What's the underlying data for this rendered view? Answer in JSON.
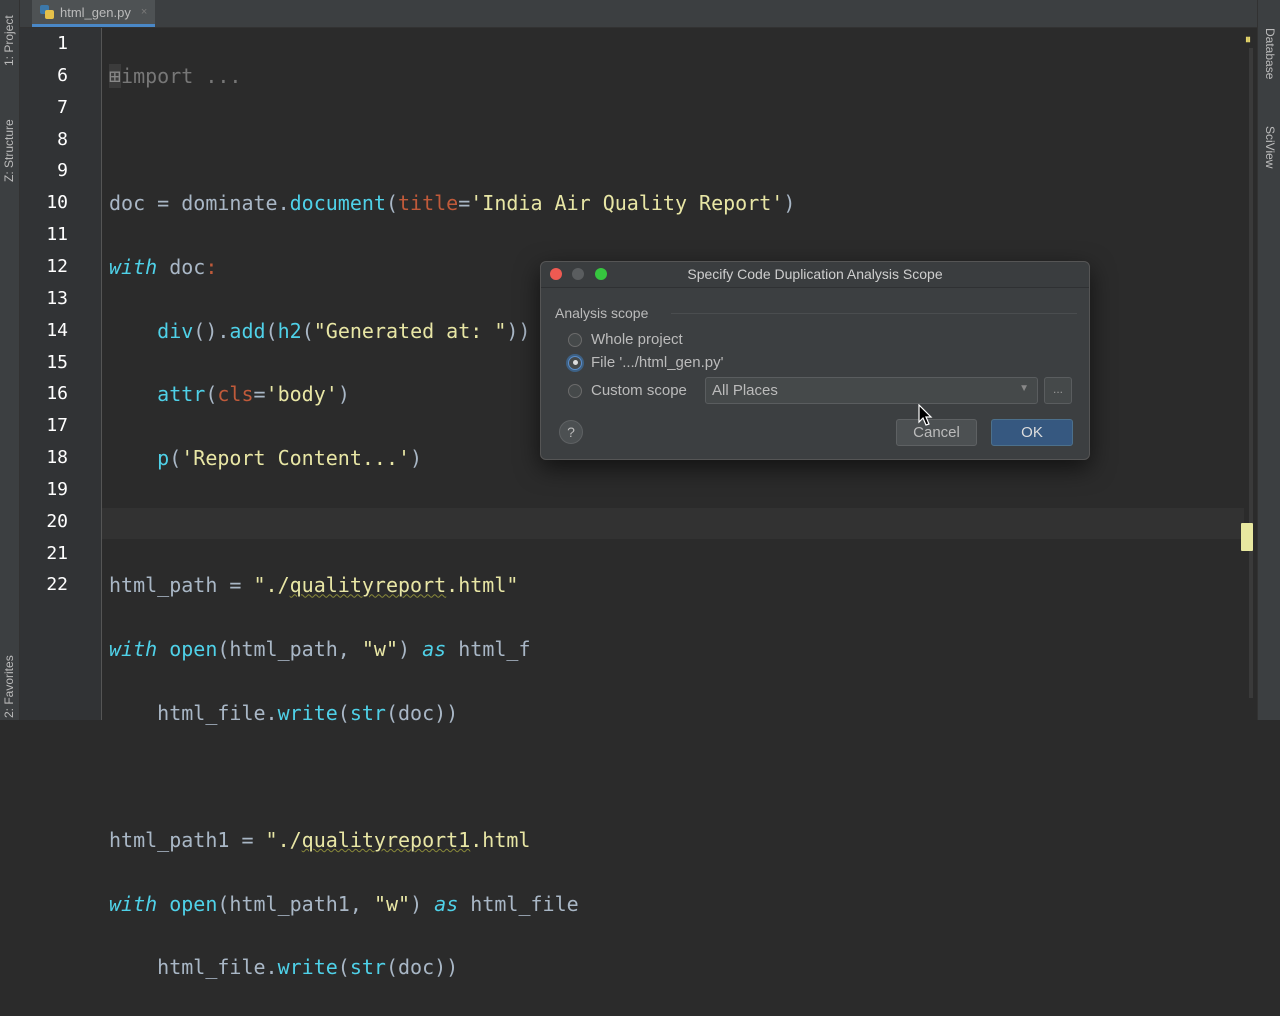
{
  "tab": {
    "filename": "html_gen.py",
    "close": "×"
  },
  "left_tools": {
    "project": "1: Project",
    "structure": "Z: Structure",
    "favorites": "2: Favorites"
  },
  "right_tools": {
    "database": "Database",
    "sciview": "SciView"
  },
  "line_numbers": [
    "1",
    "6",
    "7",
    "8",
    "9",
    "10",
    "11",
    "12",
    "13",
    "14",
    "15",
    "16",
    "17",
    "18",
    "19",
    "20",
    "21",
    "22"
  ],
  "dialog": {
    "title": "Specify Code Duplication Analysis Scope",
    "section": "Analysis scope",
    "options": {
      "whole_project": "Whole project",
      "file": "File '.../html_gen.py'",
      "custom": "Custom scope"
    },
    "selected": "file",
    "custom_value": "All Places",
    "browse": "...",
    "help": "?",
    "cancel": "Cancel",
    "ok": "OK"
  },
  "colors": {
    "accent": "#365880",
    "editor_bg": "#2b2b2b",
    "keyword": "#4fd1e8",
    "string": "#e8e6a5"
  }
}
